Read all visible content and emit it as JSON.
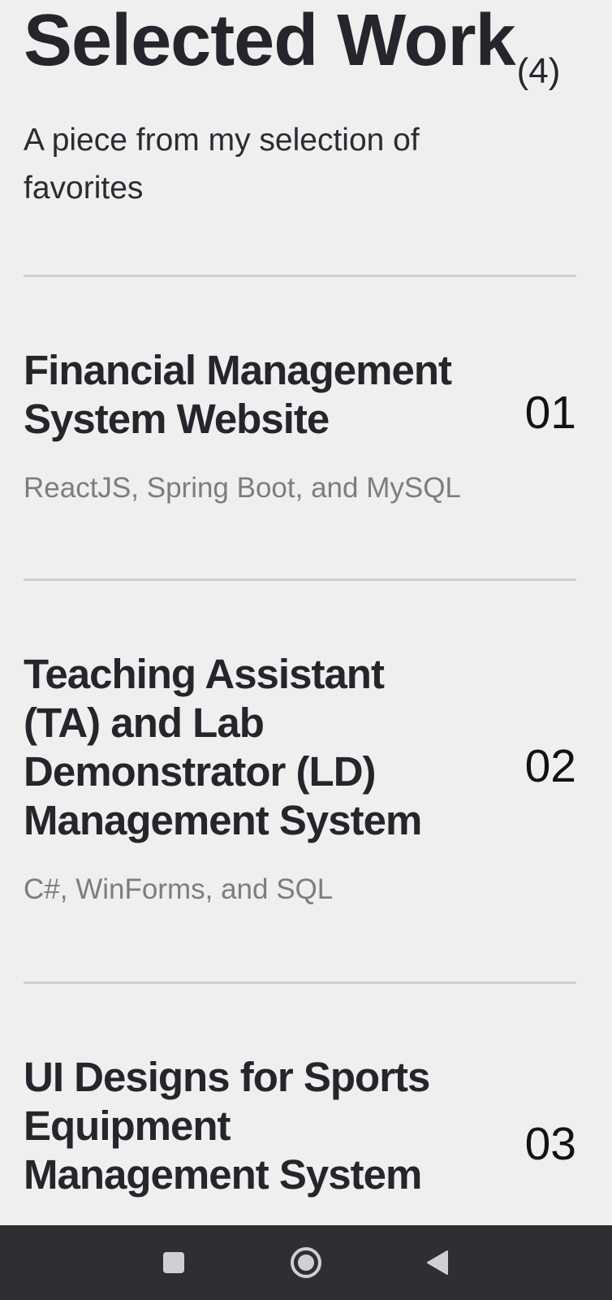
{
  "heading": {
    "title": "Selected Work",
    "count": "(4)"
  },
  "subtitle": "A piece from my selection of favorites",
  "projects": [
    {
      "title": "Financial Management System Website",
      "tech": "ReactJS, Spring Boot, and MySQL",
      "number": "01"
    },
    {
      "title": "Teaching Assistant (TA) and Lab Demonstrator (LD) Management System",
      "tech": "C#, WinForms, and SQL",
      "number": "02"
    },
    {
      "title": "UI Designs for Sports Equipment Management System",
      "number": "03"
    }
  ],
  "navbar": {
    "buttons": [
      {
        "icon": "square-recents-icon"
      },
      {
        "icon": "circle-home-icon"
      },
      {
        "icon": "triangle-back-icon"
      }
    ]
  },
  "colors": {
    "background": "#efefef",
    "heading": "#25262b",
    "muted_text": "#7c7d80",
    "divider": "#cfcfcf",
    "navbar": "#2e2f33",
    "nav_icon": "#d0d0d2"
  }
}
